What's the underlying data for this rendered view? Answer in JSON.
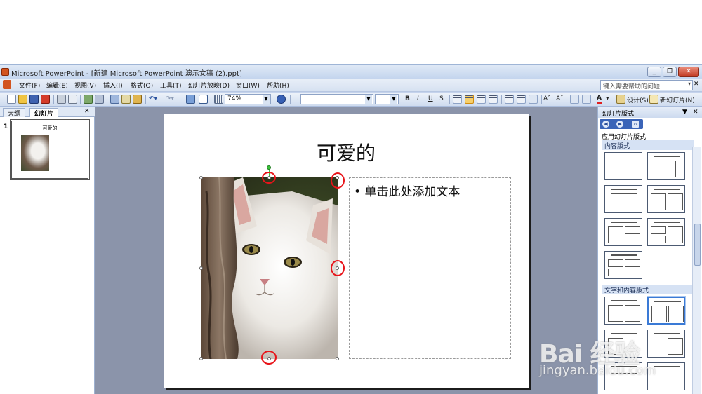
{
  "window": {
    "title": "Microsoft PowerPoint - [新建 Microsoft PowerPoint 演示文稿 (2).ppt]",
    "buttons": [
      "_",
      "❐",
      "✕"
    ]
  },
  "menu": {
    "items": [
      "文件(F)",
      "编辑(E)",
      "视图(V)",
      "插入(I)",
      "格式(O)",
      "工具(T)",
      "幻灯片放映(D)",
      "窗口(W)",
      "帮助(H)"
    ],
    "help_placeholder": "键入需要帮助的问题",
    "doc_close": "✕"
  },
  "toolbar": {
    "zoom": "74%",
    "design_label": "设计(S)",
    "new_slide_label": "新幻灯片(N)",
    "font_buttons": [
      "B",
      "I",
      "U",
      "S"
    ],
    "font_color_label": "A"
  },
  "outline_pane": {
    "tabs": [
      "大纲",
      "幻灯片"
    ],
    "close": "✕",
    "thumbnail": {
      "number": "1",
      "title": "可爱的"
    }
  },
  "slide": {
    "title": "可爱的",
    "body_bullet": "单击此处添加文本"
  },
  "task_pane": {
    "title": "幻灯片版式",
    "apply_label": "应用幻灯片版式:",
    "sections": [
      "内容版式",
      "文字和内容版式"
    ]
  },
  "watermark": {
    "logo": "Bai 经验",
    "url": "jingyan.baidu.com"
  },
  "colors": {
    "annotation_circle": "#e8141a",
    "slide_background": "#ffffff",
    "canvas_background": "#8b94aa"
  }
}
